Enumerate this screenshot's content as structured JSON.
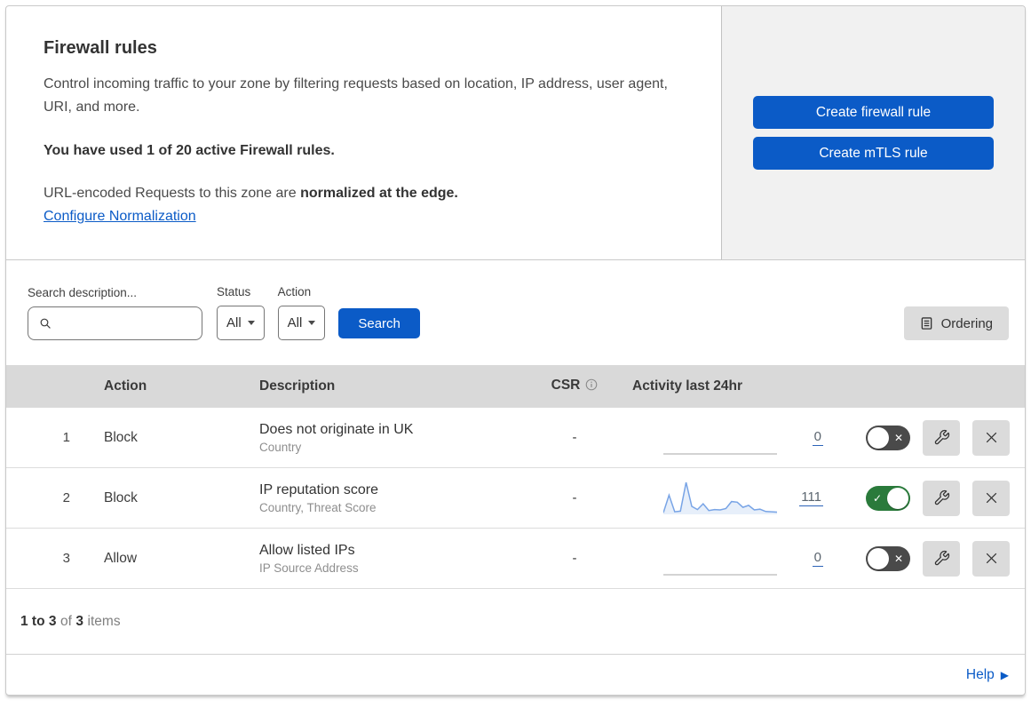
{
  "header": {
    "title": "Firewall rules",
    "description": "Control incoming traffic to your zone by filtering requests based on location, IP address, user agent, URI, and more.",
    "usage": "You have used 1 of 20 active Firewall rules.",
    "normalization_text": "URL-encoded Requests to this zone are ",
    "normalization_bold": "normalized at the edge.",
    "normalization_link": "Configure Normalization",
    "buttons": [
      {
        "label": "Create firewall rule"
      },
      {
        "label": "Create mTLS rule"
      }
    ]
  },
  "filters": {
    "search_label": "Search description...",
    "search_value": "",
    "status_label": "Status",
    "status_value": "All",
    "action_label": "Action",
    "action_value": "All",
    "search_button": "Search",
    "ordering_button": "Ordering"
  },
  "table": {
    "columns": {
      "action": "Action",
      "description": "Description",
      "csr": "CSR",
      "activity": "Activity last 24hr"
    },
    "rows": [
      {
        "priority": "1",
        "action": "Block",
        "title": "Does not originate in UK",
        "subtitle": "Country",
        "csr": "-",
        "count": "0",
        "enabled": false,
        "has_activity": false
      },
      {
        "priority": "2",
        "action": "Block",
        "title": "IP reputation score",
        "subtitle": "Country, Threat Score",
        "csr": "-",
        "count": "111",
        "enabled": true,
        "has_activity": true
      },
      {
        "priority": "3",
        "action": "Allow",
        "title": "Allow listed IPs",
        "subtitle": "IP Source Address",
        "csr": "-",
        "count": "0",
        "enabled": false,
        "has_activity": false
      }
    ],
    "sparkline_values": [
      5,
      60,
      8,
      10,
      100,
      25,
      15,
      33,
      12,
      15,
      14,
      18,
      40,
      38,
      22,
      28,
      14,
      16,
      9,
      8,
      7
    ]
  },
  "footer": {
    "range": "1 to 3",
    "of": "of",
    "total": "3",
    "items": "items",
    "help": "Help"
  },
  "icons": {
    "toggle_check": "✓",
    "toggle_cross": "✕",
    "help_arrow": "▶"
  },
  "colors": {
    "primary_blue": "#0b5bc7",
    "toggle_on_green": "#2a7a3b",
    "toggle_off_gray": "#4a4a4a",
    "sparkline_blue": "#78a4e6",
    "table_header_gray": "#d9d9d9",
    "panel_gray": "#f1f1f1"
  }
}
